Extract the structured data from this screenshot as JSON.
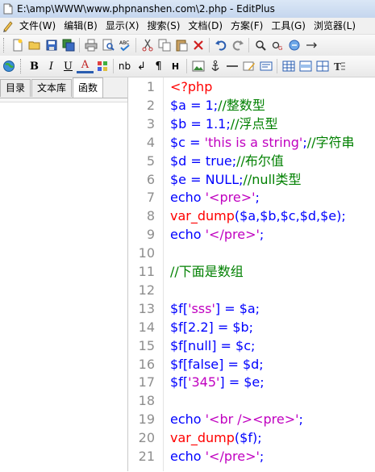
{
  "window": {
    "title": "E:\\amp\\WWW\\www.phpnanshen.com\\2.php - EditPlus"
  },
  "menu": {
    "items": [
      "文件(W)",
      "编辑(B)",
      "显示(X)",
      "搜索(S)",
      "文档(D)",
      "方案(F)",
      "工具(G)",
      "浏览器(L)"
    ]
  },
  "toolbar1": {
    "icons": [
      "new-file-icon",
      "open-folder-icon",
      "save-icon",
      "save-all-icon",
      "print-icon",
      "print-preview-icon",
      "spellcheck-icon",
      "cut-icon",
      "copy-icon",
      "paste-icon",
      "delete-icon",
      "undo-icon",
      "redo-icon",
      "find-icon",
      "replace-icon",
      "goto-icon",
      "toggle-icon"
    ]
  },
  "toolbar2": {
    "glyphs": {
      "bold": "B",
      "italic": "I",
      "underline": "U",
      "font_color": "A",
      "nb": "nb",
      "br": "↲",
      "para": "¶",
      "heading": "H"
    }
  },
  "left_pane": {
    "tabs": [
      "目录",
      "文本库",
      "函数"
    ],
    "active_tab": "函数"
  },
  "colors": {
    "keyword": "#0000ff",
    "comment": "#008000",
    "string": "#c000c0",
    "function": "#ff0000",
    "line_number": "#8e8e8e"
  },
  "editor": {
    "line_numbers": [
      "1",
      "2",
      "3",
      "4",
      "5",
      "6",
      "7",
      "8",
      "9",
      "10",
      "11",
      "12",
      "13",
      "14",
      "15",
      "16",
      "17",
      "18",
      "19",
      "20",
      "21"
    ],
    "lines": [
      [
        {
          "t": "<?php",
          "c": "c-red"
        }
      ],
      [
        {
          "t": "$a = 1;",
          "c": "c-blue"
        },
        {
          "t": "//整数型",
          "c": "c-green"
        }
      ],
      [
        {
          "t": "$b = 1.1;",
          "c": "c-blue"
        },
        {
          "t": "//浮点型",
          "c": "c-green"
        }
      ],
      [
        {
          "t": "$c = ",
          "c": "c-blue"
        },
        {
          "t": "'this is a string'",
          "c": "c-magenta"
        },
        {
          "t": ";",
          "c": "c-blue"
        },
        {
          "t": "//字符串",
          "c": "c-green"
        }
      ],
      [
        {
          "t": "$d = true;",
          "c": "c-blue"
        },
        {
          "t": "//布尔值",
          "c": "c-green"
        }
      ],
      [
        {
          "t": "$e = NULL;",
          "c": "c-blue"
        },
        {
          "t": "//null类型",
          "c": "c-green"
        }
      ],
      [
        {
          "t": "echo ",
          "c": "c-blue"
        },
        {
          "t": "'<pre>'",
          "c": "c-magenta"
        },
        {
          "t": ";",
          "c": "c-blue"
        }
      ],
      [
        {
          "t": "var_dump",
          "c": "c-red"
        },
        {
          "t": "($a,$b,$c,$d,$e);",
          "c": "c-blue"
        }
      ],
      [
        {
          "t": "echo ",
          "c": "c-blue"
        },
        {
          "t": "'</pre>'",
          "c": "c-magenta"
        },
        {
          "t": ";",
          "c": "c-blue"
        }
      ],
      [],
      [
        {
          "t": "//下面是数组",
          "c": "c-green"
        }
      ],
      [],
      [
        {
          "t": "$f[",
          "c": "c-blue"
        },
        {
          "t": "'sss'",
          "c": "c-magenta"
        },
        {
          "t": "] = $a;",
          "c": "c-blue"
        }
      ],
      [
        {
          "t": "$f[2.2] = $b;",
          "c": "c-blue"
        }
      ],
      [
        {
          "t": "$f[null] = $c;",
          "c": "c-blue"
        }
      ],
      [
        {
          "t": "$f[false] = $d;",
          "c": "c-blue"
        }
      ],
      [
        {
          "t": "$f[",
          "c": "c-blue"
        },
        {
          "t": "'345'",
          "c": "c-magenta"
        },
        {
          "t": "] = $e;",
          "c": "c-blue"
        }
      ],
      [],
      [
        {
          "t": "echo ",
          "c": "c-blue"
        },
        {
          "t": "'<br /><pre>'",
          "c": "c-magenta"
        },
        {
          "t": ";",
          "c": "c-blue"
        }
      ],
      [
        {
          "t": "var_dump",
          "c": "c-red"
        },
        {
          "t": "($f);",
          "c": "c-blue"
        }
      ],
      [
        {
          "t": "echo ",
          "c": "c-blue"
        },
        {
          "t": "'</pre>'",
          "c": "c-magenta"
        },
        {
          "t": ";",
          "c": "c-blue"
        }
      ]
    ]
  }
}
